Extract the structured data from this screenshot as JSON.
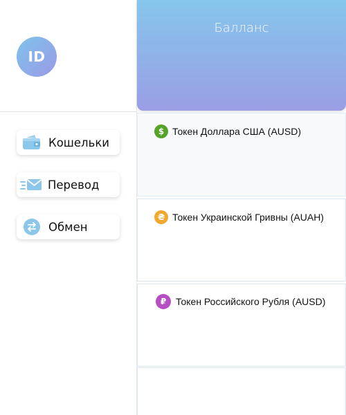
{
  "user": {
    "initials": "ID"
  },
  "nav": {
    "wallets": "Кошельки",
    "transfer": "Перевод",
    "exchange": "Обмен"
  },
  "balance": {
    "title": "Балланс"
  },
  "tokens": [
    {
      "name": "Токен Доллара США (AUSD)",
      "symbol": "$",
      "icon": "dollar-icon",
      "color": "#56a329"
    },
    {
      "name": "Токен Украинской Гривны (AUAH)",
      "symbol": "₴",
      "icon": "hryvnia-icon",
      "color": "#f2a72e"
    },
    {
      "name": "Токен Российского Рубля (AUSD)",
      "symbol": "₽",
      "icon": "ruble-icon",
      "color": "#b64fc2"
    }
  ],
  "colors": {
    "header_gradient_start": "#86c6ec",
    "header_gradient_end": "#9a9ee4",
    "avatar_gradient_start": "#7fc3ec",
    "avatar_gradient_end": "#9a9ae6"
  }
}
